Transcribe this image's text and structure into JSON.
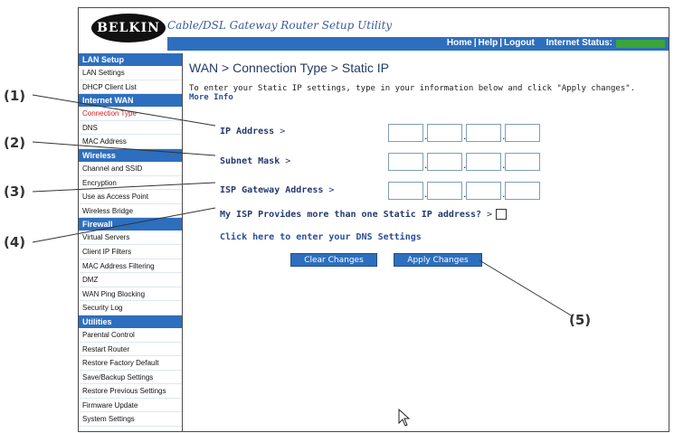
{
  "header": {
    "logo_text": "BELKIN",
    "utility_title": "Cable/DSL Gateway Router Setup Utility",
    "links": [
      "Home",
      "Help",
      "Logout"
    ],
    "link_separator": "|",
    "internet_status_label": "Internet Status:",
    "status_color": "#3aa63a"
  },
  "sidebar": {
    "sections": [
      {
        "title": "LAN Setup",
        "items": [
          "LAN Settings",
          "DHCP Client List"
        ]
      },
      {
        "title": "Internet WAN",
        "items": [
          "Connection Type",
          "DNS",
          "MAC Address"
        ]
      },
      {
        "title": "Wireless",
        "items": [
          "Channel and SSID",
          "Encryption",
          "Use as Access Point",
          "Wireless Bridge"
        ]
      },
      {
        "title": "Firewall",
        "items": [
          "Virtual Servers",
          "Client IP Filters",
          "MAC Address Filtering",
          "DMZ",
          "WAN Ping Blocking",
          "Security Log"
        ]
      },
      {
        "title": "Utilities",
        "items": [
          "Parental Control",
          "Restart Router",
          "Restore Factory Default",
          "Save/Backup Settings",
          "Restore Previous Settings",
          "Firmware Update",
          "System Settings"
        ]
      }
    ],
    "active_item": "Connection Type"
  },
  "main": {
    "title": "WAN > Connection Type > Static IP",
    "intro": "To enter your Static IP settings, type in your information below and click \"Apply changes\".",
    "more_info": "More Info",
    "fields": [
      {
        "label": "IP Address",
        "suffix": ">"
      },
      {
        "label": "Subnet Mask",
        "suffix": ">"
      },
      {
        "label": "ISP Gateway Address",
        "suffix": ">"
      }
    ],
    "multi_ip_label": "My ISP Provides more than one Static IP address?",
    "multi_ip_suffix": ">",
    "dns_link": "Click here to enter your DNS Settings",
    "clear_button": "Clear Changes",
    "apply_button": "Apply Changes",
    "ip_separator": "."
  },
  "callouts": [
    "(1)",
    "(2)",
    "(3)",
    "(4)",
    "(5)"
  ],
  "colors": {
    "accent": "#2d6fbe",
    "title_text": "#233a66",
    "active_item": "#cc2222"
  }
}
